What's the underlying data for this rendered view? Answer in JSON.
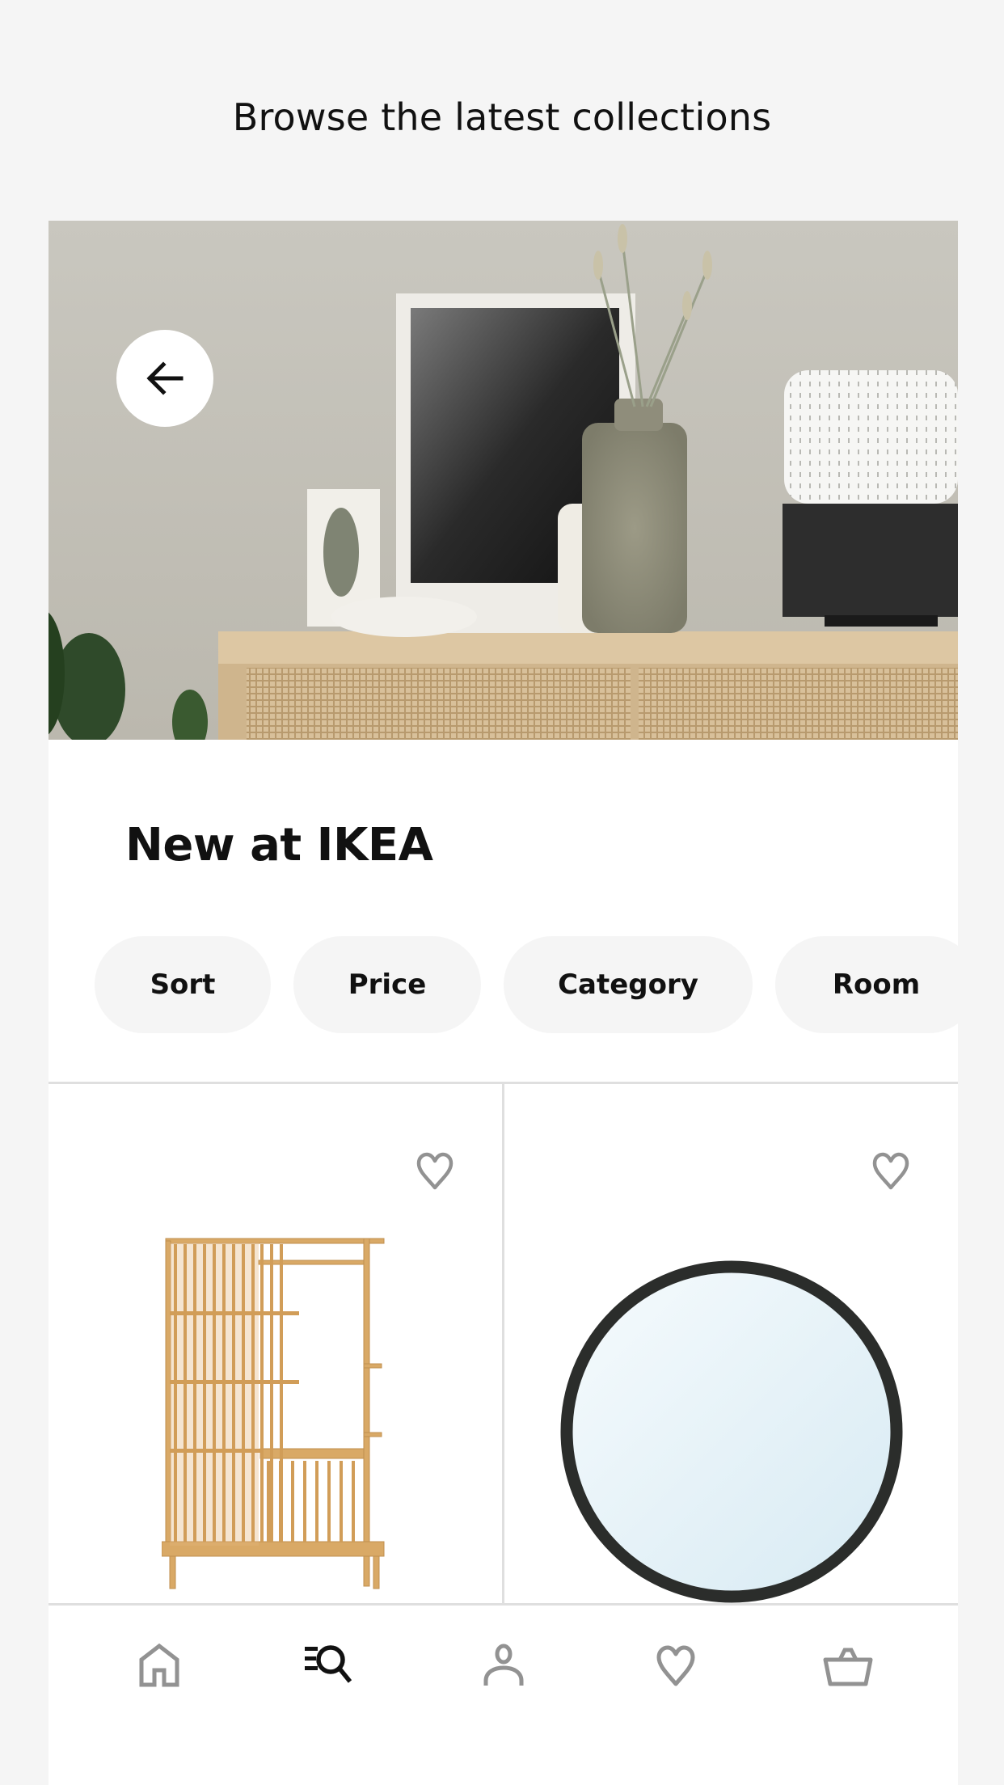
{
  "header": {
    "title": "Browse the latest collections"
  },
  "hero": {
    "image": "living-room-sideboard-with-vases-and-art",
    "back_button": "back-arrow-icon"
  },
  "section": {
    "title": "New at IKEA"
  },
  "filters": [
    {
      "label": "Sort"
    },
    {
      "label": "Price"
    },
    {
      "label": "Category"
    },
    {
      "label": "Room"
    }
  ],
  "products": [
    {
      "image": "bamboo-open-wardrobe",
      "favorite_icon": "heart-outline-icon",
      "favorited": false
    },
    {
      "image": "round-mirror-black-frame",
      "favorite_icon": "heart-outline-icon",
      "favorited": false
    }
  ],
  "bottom_nav": {
    "items": [
      {
        "name": "home",
        "icon": "home-icon",
        "active": false
      },
      {
        "name": "search",
        "icon": "search-list-icon",
        "active": true
      },
      {
        "name": "profile",
        "icon": "person-icon",
        "active": false
      },
      {
        "name": "favorites",
        "icon": "heart-icon",
        "active": false
      },
      {
        "name": "cart",
        "icon": "basket-icon",
        "active": false
      }
    ]
  },
  "colors": {
    "background": "#f5f5f5",
    "card": "#ffffff",
    "chip": "#f5f5f5",
    "text": "#111111",
    "icon_inactive": "#929292",
    "icon_active": "#111111",
    "divider": "#dfdfdf"
  }
}
